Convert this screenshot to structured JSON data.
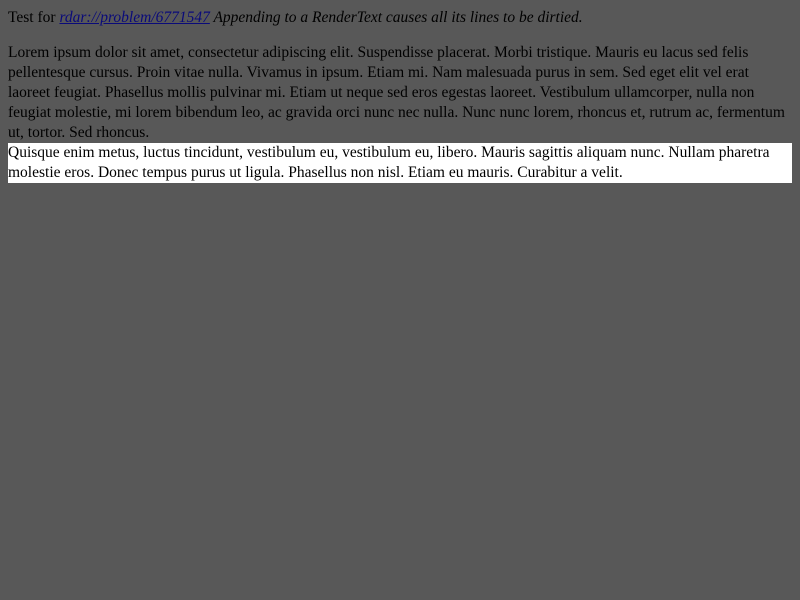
{
  "header": {
    "prefix": "Test for ",
    "link_text": "rdar://problem/6771547",
    "description": " Appending to a RenderText causes all its lines to be dirtied."
  },
  "paragraph": {
    "dirty_text": "Lorem ipsum dolor sit amet, consectetur adipiscing elit. Suspendisse placerat. Morbi tristique. Mauris eu lacus sed felis pellentesque cursus. Proin vitae nulla. Vivamus in ipsum. Etiam mi. Nam malesuada purus in sem. Sed eget elit vel erat laoreet feugiat. Phasellus mollis pulvinar mi. Etiam ut neque sed eros egestas laoreet. Vestibulum ullamcorper, nulla non feugiat molestie, mi lorem bibendum leo, ac gravida orci nunc nec nulla. Nunc nunc lorem, rhoncus et, rutrum ac, fermentum ut, tortor. Sed rhoncus.",
    "clean_text": "Quisque enim metus, luctus tincidunt, vestibulum eu, vestibulum eu, libero. Mauris sagittis aliquam nunc. Nullam pharetra molestie eros. Donec tempus purus ut ligula. Phasellus non nisl. Etiam eu mauris. Curabitur a velit."
  },
  "colors": {
    "background": "#585858",
    "link": "#0a0a7a",
    "highlight": "#ffffff"
  }
}
